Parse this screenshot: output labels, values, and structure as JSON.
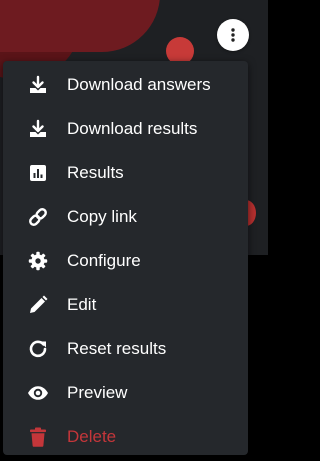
{
  "kebab_button": {
    "icon": "more-vertical-icon"
  },
  "menu": {
    "items": [
      {
        "label": "Download answers",
        "icon": "download-icon"
      },
      {
        "label": "Download results",
        "icon": "download-icon"
      },
      {
        "label": "Results",
        "icon": "bar-chart-icon"
      },
      {
        "label": "Copy link",
        "icon": "link-icon"
      },
      {
        "label": "Configure",
        "icon": "gear-icon"
      },
      {
        "label": "Edit",
        "icon": "pencil-icon"
      },
      {
        "label": "Reset results",
        "icon": "refresh-icon"
      },
      {
        "label": "Preview",
        "icon": "eye-icon"
      },
      {
        "label": "Delete",
        "icon": "trash-icon"
      }
    ]
  },
  "colors": {
    "menu_background": "#25282c",
    "text": "#ffffff",
    "danger": "#c4363a",
    "accent_red": "#c73a38"
  }
}
